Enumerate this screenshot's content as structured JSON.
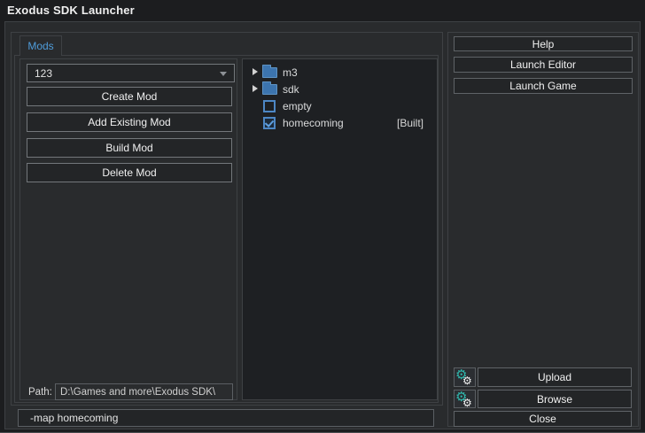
{
  "window": {
    "title": "Exodus SDK Launcher"
  },
  "tabs": [
    {
      "label": "Mods",
      "active": true
    }
  ],
  "mods_panel": {
    "mod_dropdown": {
      "value": "123"
    },
    "create_button": "Create Mod",
    "add_existing_button": "Add Existing Mod",
    "build_button": "Build Mod",
    "delete_button": "Delete Mod",
    "path_label": "Path:",
    "path_value": "D:\\Games and more\\Exodus SDK\\"
  },
  "mod_tree": {
    "items": [
      {
        "label": "m3",
        "kind": "folder",
        "expandable": true,
        "status": ""
      },
      {
        "label": "sdk",
        "kind": "folder",
        "expandable": true,
        "status": ""
      },
      {
        "label": "empty",
        "kind": "checkbox",
        "checked": false,
        "status": ""
      },
      {
        "label": "homecoming",
        "kind": "checkbox",
        "checked": true,
        "status": "[Built]"
      }
    ]
  },
  "command_bar": {
    "value": "-map homecoming"
  },
  "actions_panel": {
    "help_button": "Help",
    "launch_editor_button": "Launch Editor",
    "launch_game_button": "Launch Game",
    "upload_button": "Upload",
    "browse_button": "Browse",
    "close_button": "Close",
    "upload_icon": "modio-gears-icon",
    "browse_icon": "modio-gears-icon"
  },
  "colors": {
    "accent_blue": "#4f9cda",
    "checkbox_blue": "#4d87c5",
    "folder_blue": "#3c74ae",
    "modio_teal": "#30b7ac",
    "status_built_text": "#d6d6d6"
  }
}
